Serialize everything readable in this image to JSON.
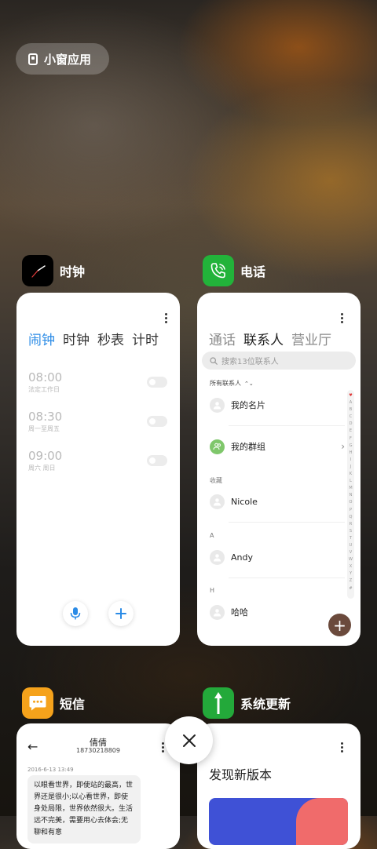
{
  "floating_pill": {
    "label": "小窗应用",
    "icon": "small-window-icon"
  },
  "clock_app": {
    "name": "时钟",
    "tabs": [
      "闹钟",
      "时钟",
      "秒表",
      "计时"
    ],
    "alarms": [
      {
        "time": "08:00",
        "label": "法定工作日"
      },
      {
        "time": "08:30",
        "label": "周一至周五"
      },
      {
        "time": "09:00",
        "label": "周六 周日"
      }
    ]
  },
  "phone_app": {
    "name": "电话",
    "tabs": [
      "通话",
      "联系人",
      "营业厅"
    ],
    "search_placeholder": "搜索13位联系人",
    "filter": "所有联系人",
    "my_card": "我的名片",
    "my_group": "我的群组",
    "sections": [
      {
        "header": "收藏",
        "name": "Nicole"
      },
      {
        "header": "A",
        "name": "Andy"
      },
      {
        "header": "H",
        "name": "哈哈"
      }
    ],
    "alphabet": [
      "♥",
      "A",
      "B",
      "C",
      "D",
      "E",
      "F",
      "G",
      "H",
      "I",
      "J",
      "K",
      "L",
      "M",
      "N",
      "O",
      "P",
      "Q",
      "R",
      "S",
      "T",
      "U",
      "V",
      "W",
      "X",
      "Y",
      "Z",
      "#"
    ]
  },
  "sms_app": {
    "name": "短信",
    "contact_name": "倩倩",
    "contact_number": "18730218809",
    "date": "2016-6-13 13:49",
    "message": "以眼看世界，即使站的最高，世界还是很小;以心看世界，即使身处局限，世界依然很大。生活远不完美，需要用心去体会;无聊和有意"
  },
  "update_app": {
    "name": "系统更新",
    "title": "发现新版本"
  },
  "colors": {
    "clock_active": "#2b8be6",
    "phone_green": "#22b33a",
    "sms_orange": "#f5a21b",
    "update_green": "#23a93a",
    "fab_brown": "#6b4a3c"
  }
}
